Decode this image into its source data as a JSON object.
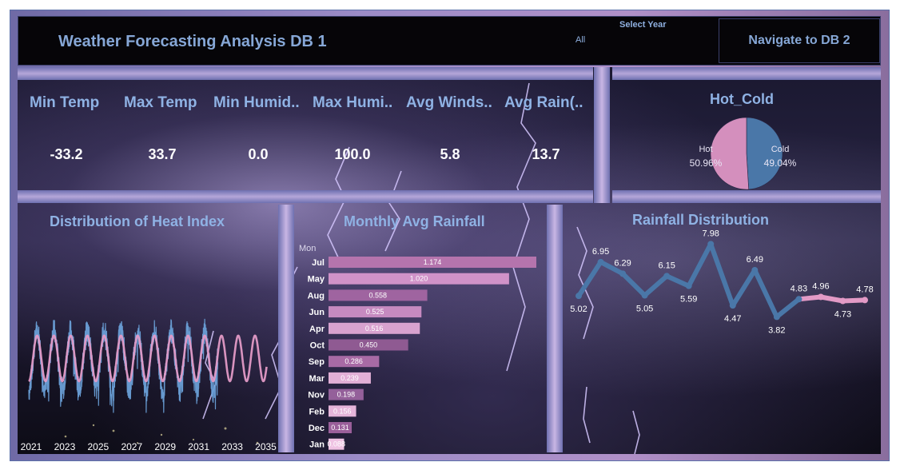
{
  "header": {
    "title": "Weather Forecasting Analysis DB 1",
    "select_year_label": "Select Year",
    "select_year_value": "All",
    "navigate_button": "Navigate to DB 2"
  },
  "kpis": [
    {
      "label": "Min Temp",
      "value": "-33.2"
    },
    {
      "label": "Max Temp",
      "value": "33.7"
    },
    {
      "label": "Min Humid..",
      "value": "0.0"
    },
    {
      "label": "Max Humi..",
      "value": "100.0"
    },
    {
      "label": "Avg Winds..",
      "value": "5.8"
    },
    {
      "label": "Avg  Rain(..",
      "value": "13.7"
    }
  ],
  "colors": {
    "title_blue": "#86a7d6",
    "hot_pink": "#d48fbd",
    "cold_blue": "#4a77a8",
    "line_blue": "#4a77a8",
    "line_pink": "#e39ac6"
  },
  "chart_data": [
    {
      "type": "pie",
      "title": "Hot_Cold",
      "slices": [
        {
          "name": "Hot",
          "value": 50.96,
          "label": "50.96%",
          "color": "#d48fbd"
        },
        {
          "name": "Cold",
          "value": 49.04,
          "label": "49.04%",
          "color": "#4a77a8"
        }
      ]
    },
    {
      "type": "line",
      "title": "Distribution of Heat Index",
      "x_ticks": [
        "2021",
        "2023",
        "2025",
        "2027",
        "2029",
        "2031",
        "2033",
        "2035"
      ],
      "xlim": [
        2021,
        2035.5
      ],
      "ylim": [
        0,
        1
      ],
      "series": [
        {
          "color": "#6aa0d8",
          "style": "noisy seasonal",
          "x_start": 2021,
          "x_end": 2032.3,
          "cycles_per_year": 1,
          "center": 0.5,
          "amplitude": 0.28,
          "noise": 0.12
        },
        {
          "color": "#e39ac6",
          "style": "smooth seasonal",
          "x_start": 2021,
          "x_end": 2035.2,
          "cycles_per_year": 1,
          "center": 0.52,
          "amplitude": 0.22,
          "noise": 0
        }
      ]
    },
    {
      "type": "bar",
      "orientation": "horizontal",
      "title": "Monthly Avg   Rainfall",
      "axis_header": "Mon",
      "categories": [
        "Jul",
        "May",
        "Aug",
        "Jun",
        "Apr",
        "Oct",
        "Sep",
        "Mar",
        "Nov",
        "Feb",
        "Dec",
        "Jan"
      ],
      "values": [
        1.174,
        1.02,
        0.558,
        0.525,
        0.516,
        0.45,
        0.286,
        0.239,
        0.198,
        0.156,
        0.131,
        0.088
      ],
      "value_labels": [
        "1.174",
        "1.020",
        "0.558",
        "0.525",
        "0.516",
        "0.450",
        "0.286",
        "0.239",
        "0.198",
        "0.156",
        "0.131",
        "0.088"
      ],
      "colors": [
        "#b574ad",
        "#d092c8",
        "#9f64a0",
        "#c68ac0",
        "#d8a2cf",
        "#8f5a92",
        "#a86aa5",
        "#e2afd6",
        "#94609a",
        "#e6b5da",
        "#9a5f9a",
        "#efc3e3"
      ],
      "xlim": [
        0,
        1.174
      ]
    },
    {
      "type": "line",
      "title": "Rainfall Distribution",
      "values": [
        5.02,
        6.95,
        6.29,
        5.05,
        6.15,
        5.59,
        7.98,
        4.47,
        6.49,
        3.82,
        4.83,
        4.96,
        4.73,
        4.78
      ],
      "labels": [
        "5.02",
        "6.95",
        "6.29",
        "5.05",
        "6.15",
        "5.59",
        "7.98",
        "4.47",
        "6.49",
        "3.82",
        "4.83",
        "4.96",
        "4.73",
        "4.78"
      ],
      "series_split_index": 10,
      "ylim": [
        0,
        8.5
      ]
    }
  ]
}
